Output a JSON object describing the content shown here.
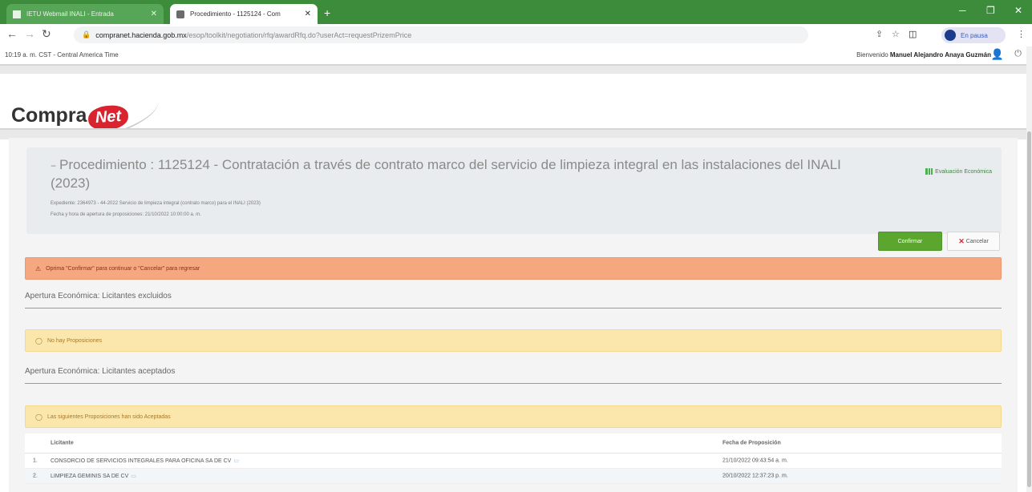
{
  "browser": {
    "tabs": [
      {
        "title": "IETU Webmail INALI - Entrada",
        "active": false
      },
      {
        "title": "Procedimiento - 1125124 - Com",
        "active": true
      }
    ],
    "new_tab": "+",
    "url_host": "compranet.hacienda.gob.mx",
    "url_path": "/esop/toolkit/negotiation/rfq/awardRfq.do?userAct=requestPrizemPrice",
    "profile_label": "En pausa",
    "colors": {
      "chrome_green": "#3c8c3c"
    }
  },
  "header": {
    "time_text": "10:19 a. m. CST - Central America Time",
    "welcome_prefix": "Bienvenido",
    "user_name": "Manuel Alejandro Anaya Guzmán",
    "logo_text": "Compra",
    "logo_badge": "Net"
  },
  "procedure": {
    "collapse_glyph": "−",
    "title": "Procedimiento : 1125124 - Contratación a través de contrato marco del servicio de limpieza integral en las instalaciones del INALI (2023)",
    "expediente": "Expediente: 2364973 - 44-2022 Servicio de limpieza integral (contrato marco) para el INALI (2023)",
    "apertura": "Fecha y hora de apertura de proposiciones: 21/10/2022 10:00:00 a. m.",
    "eval_link": "Evaluación Económica"
  },
  "actions": {
    "confirm": "Confirmar",
    "cancel": "Cancelar"
  },
  "alerts": {
    "warning": "Oprima \"Confirmar\" para continuar o \"Cancelar\" para regresar",
    "no_proposals": "No hay Proposiciones",
    "accepted_note": "Las siguientes Proposiciones han sido Aceptadas"
  },
  "sections": {
    "excluded_title": "Apertura Económica: Licitantes excluidos",
    "accepted_title": "Apertura Económica: Licitantes aceptados"
  },
  "table": {
    "headers": {
      "bidder": "Licitante",
      "date": "Fecha de Proposición"
    },
    "rows": [
      {
        "num": "1.",
        "name": "CONSORCIO DE SERVICIOS INTEGRALES PARA OFICINA SA DE CV",
        "date": "21/10/2022 09:43:54 a. m."
      },
      {
        "num": "2.",
        "name": "LIMPIEZA GEMINIS SA DE CV",
        "date": "20/10/2022 12:37:23 p. m."
      }
    ]
  }
}
